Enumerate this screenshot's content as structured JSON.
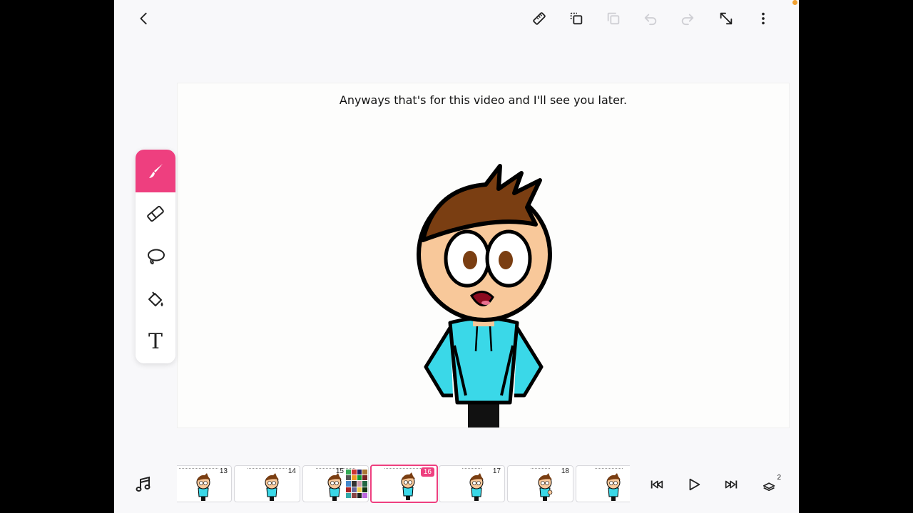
{
  "canvas": {
    "caption": "Anyways that's for this video and I'll see you later."
  },
  "toolbar": {
    "buttons": [
      "back-icon",
      "ruler-icon",
      "duplicate-icon",
      "copy-icon",
      "undo-icon",
      "redo-icon",
      "expand-icon",
      "more-icon"
    ]
  },
  "tools": {
    "items": [
      "brush",
      "eraser",
      "lasso",
      "fill",
      "text"
    ],
    "active": "brush",
    "text_label": "T"
  },
  "timeline": {
    "frames": [
      {
        "num": "13"
      },
      {
        "num": "14"
      },
      {
        "num": "15"
      },
      {
        "num": "16"
      },
      {
        "num": "17"
      },
      {
        "num": "18"
      },
      {
        "num": ""
      }
    ],
    "current": "16",
    "layers_badge": "2"
  },
  "colors": {
    "accent": "#ee3f7f",
    "hoodie": "#3ad8e8",
    "hair": "#7a3e12",
    "skin": "#f8c89a"
  }
}
